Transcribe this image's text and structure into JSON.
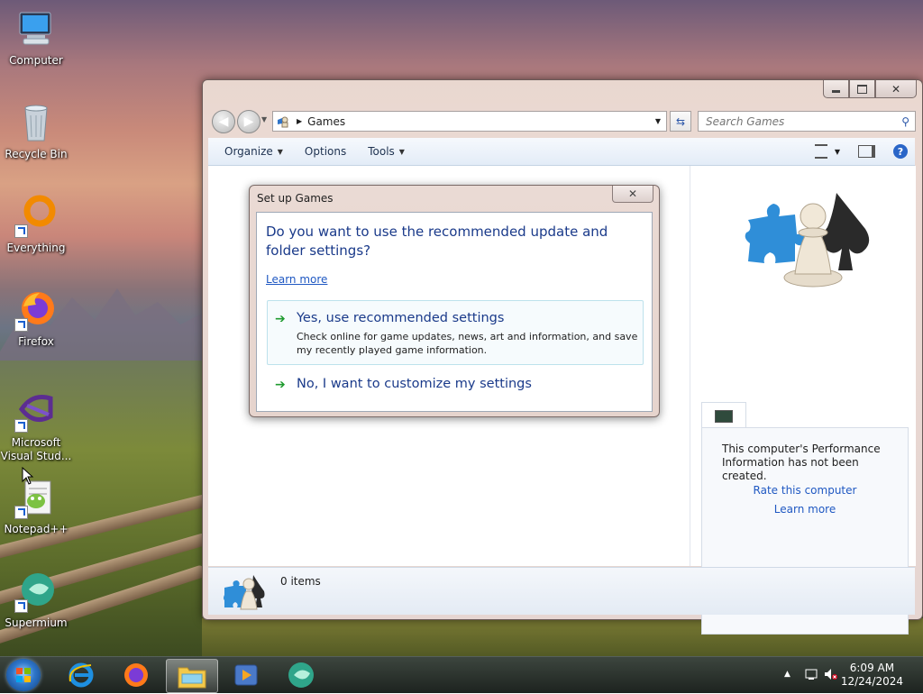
{
  "desktop": {
    "icons": [
      {
        "label": "Computer"
      },
      {
        "label": "Recycle Bin"
      },
      {
        "label": "Everything"
      },
      {
        "label": "Firefox"
      },
      {
        "label": "Microsoft Visual Stud..."
      },
      {
        "label": "Notepad++"
      },
      {
        "label": "Supermium"
      }
    ]
  },
  "explorer": {
    "address": "Games",
    "search_placeholder": "Search Games",
    "toolbar": {
      "organize": "Organize",
      "options": "Options",
      "tools": "Tools"
    },
    "details": {
      "performance_text": "This computer's Performance Information has not been created.",
      "rate_link": "Rate this computer",
      "learn_link": "Learn more"
    },
    "status": {
      "items": "0 items"
    }
  },
  "dialog": {
    "title": "Set up Games",
    "question": "Do you want to use the recommended update and folder settings?",
    "learn_more": "Learn more",
    "option_yes": {
      "label": "Yes, use recommended settings",
      "description": "Check online for game updates, news, art and information, and save my recently played game information."
    },
    "option_no": {
      "label": "No, I want to customize my settings"
    }
  },
  "taskbar": {
    "time": "6:09 AM",
    "date": "12/24/2024",
    "apps": [
      "internet-explorer",
      "firefox",
      "file-explorer",
      "media-player",
      "supermium"
    ]
  },
  "colors": {
    "link": "#1f58c2",
    "heading": "#1a3a8a",
    "arrow": "#1f9b2f"
  }
}
